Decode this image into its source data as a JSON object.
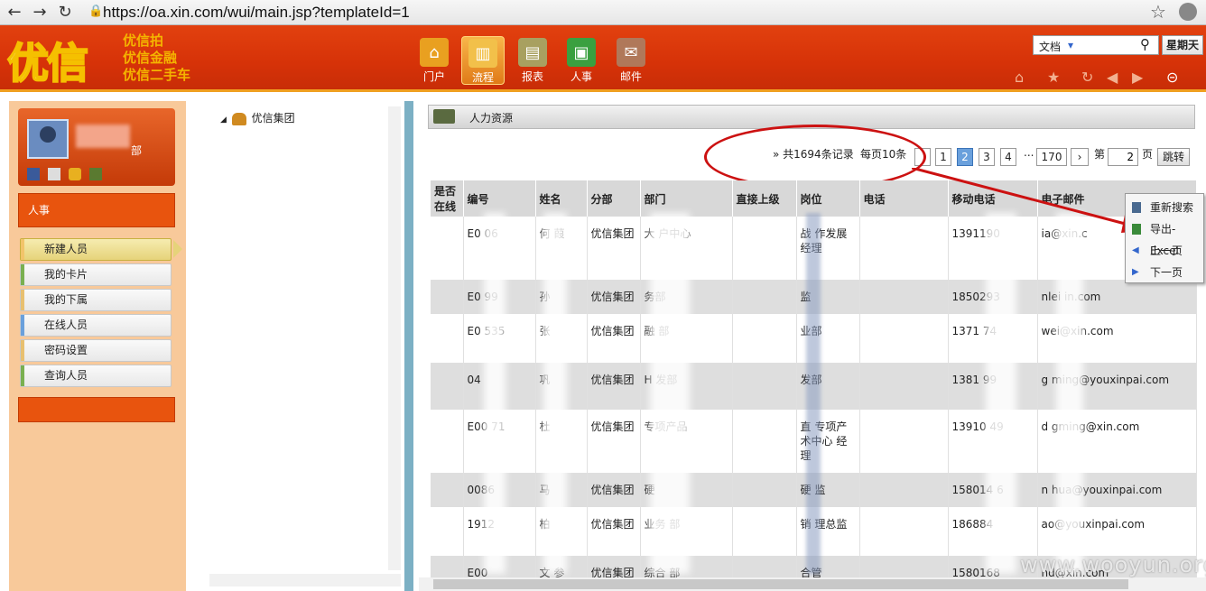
{
  "browser": {
    "url": "https://oa.xin.com/wui/main.jsp?templateId=1"
  },
  "header": {
    "logo": "优信",
    "slogans": [
      "优信拍",
      "优信金融",
      "优信二手车"
    ],
    "modules": [
      {
        "label": "门户",
        "color": "#e9a020"
      },
      {
        "label": "流程",
        "color": "#f2c04a"
      },
      {
        "label": "报表",
        "color": "#a8a060"
      },
      {
        "label": "人事",
        "color": "#3aa040"
      },
      {
        "label": "邮件",
        "color": "#b0785a"
      }
    ],
    "search_type": "文档",
    "weekday": "星期天"
  },
  "profile": {
    "dept_fragment": "部"
  },
  "sidebar": {
    "category": "人事",
    "items": [
      {
        "label": "新建人员"
      },
      {
        "label": "我的卡片"
      },
      {
        "label": "我的下属"
      },
      {
        "label": "在线人员"
      },
      {
        "label": "密码设置"
      },
      {
        "label": "查询人员"
      }
    ],
    "accent_colors": [
      "#f2c46a",
      "#7ab050",
      "#e8c070",
      "#6aa0dc",
      "#e8c070",
      "#7ab050"
    ]
  },
  "tree": {
    "root": "优信集团"
  },
  "main": {
    "title": "人力资源",
    "pager": {
      "summary": "» 共1694条记录",
      "per_page": "每页10条",
      "pages": [
        "1",
        "2",
        "3",
        "4"
      ],
      "current": "2",
      "ellipsis": "...",
      "last": "170",
      "next": "›",
      "goto_prefix": "第",
      "goto_value": "2",
      "goto_suffix": "页",
      "goto_button": "跳转"
    },
    "columns": [
      "是否在线",
      "编号",
      "姓名",
      "分部",
      "部门",
      "直接上级",
      "岗位",
      "电话",
      "移动电话",
      "电子邮件"
    ],
    "rows": [
      [
        "",
        "E0  06",
        "何  葭",
        "优信集团",
        "大  户中心",
        "",
        "战   作发展   经理",
        "",
        "1391190",
        "  ia@xin.c"
      ],
      [
        "",
        "E0   99",
        "孙",
        "优信集团",
        "  务部",
        "",
        "   监",
        "",
        "1850293",
        " nlei  in.com"
      ],
      [
        "",
        "E0  535",
        "张  ",
        "优信集团",
        "  融   部",
        "",
        "   业部",
        "",
        "1371  74",
        "   wei@xin.com"
      ],
      [
        "",
        "04",
        "巩  ",
        "优信集团",
        "  H   发部",
        "",
        "   发部",
        "",
        "1381  99",
        "g   ming@youxinpai.com"
      ],
      [
        "",
        "E00  71",
        "杜  ",
        "优信集团",
        "   专项产品",
        "",
        "直   专项产   术中心   经理",
        "",
        "13910  49",
        "d   gming@xin.com"
      ],
      [
        "",
        "0086",
        "马  ",
        "优信集团",
        "硬   ",
        "",
        "硬   监",
        "",
        "158014  6",
        "n   hua@youxinpai.com"
      ],
      [
        "",
        "1912",
        "柏",
        "优信集团",
        "业务   部",
        "",
        "销   理总监",
        "",
        "186884",
        "   ao@youxinpai.com"
      ],
      [
        "",
        "E00",
        "文  参",
        "优信集团",
        "综合   部",
        "",
        "   合管",
        "",
        "1580168",
        "    nd@xin.com"
      ]
    ]
  },
  "context_menu": {
    "items": [
      {
        "label": "重新搜索",
        "icon": "search-list-icon"
      },
      {
        "label": "导出-Excel",
        "icon": "excel-export-icon"
      },
      {
        "label": "上一页",
        "icon": "triangle-left-icon"
      },
      {
        "label": "下一页",
        "icon": "triangle-right-icon"
      }
    ]
  },
  "watermark": "www.wooyun.org"
}
